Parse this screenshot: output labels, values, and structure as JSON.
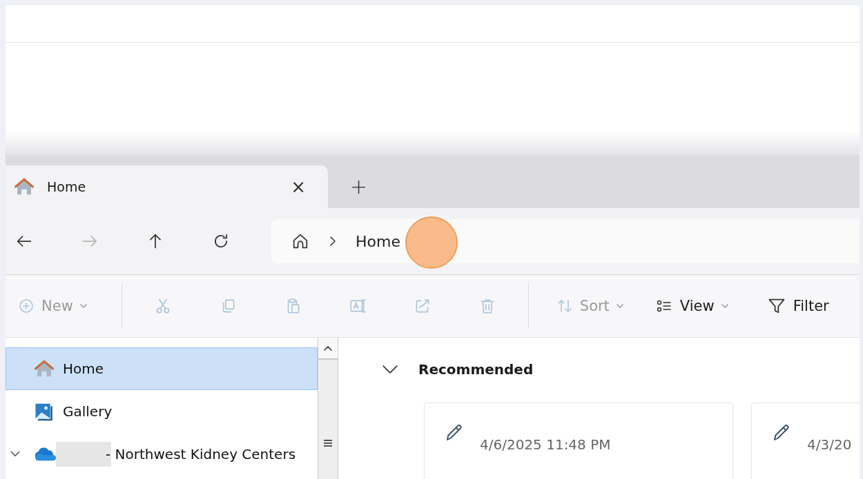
{
  "tabs": [
    {
      "label": "Home",
      "selected": true,
      "close": "×"
    }
  ],
  "new_tab_button": "+",
  "navigation": {
    "back_disabled": false,
    "forward_disabled": true,
    "address": {
      "breadcrumb": [
        "Home"
      ]
    }
  },
  "toolbar": [
    {
      "kind": "dropdown",
      "label": "New",
      "disabled": true
    },
    {
      "kind": "divider"
    },
    {
      "kind": "icon",
      "disabled": true
    },
    {
      "kind": "icon",
      "disabled": true
    },
    {
      "kind": "icon",
      "disabled": true
    },
    {
      "kind": "icon",
      "disabled": true
    },
    {
      "kind": "icon",
      "disabled": true
    },
    {
      "kind": "icon",
      "disabled": true
    },
    {
      "kind": "divider"
    },
    {
      "kind": "dropdown",
      "label": "Sort",
      "disabled": true
    },
    {
      "kind": "dropdown",
      "label": "View",
      "disabled": false
    },
    {
      "kind": "button",
      "label": "Filter",
      "disabled": false
    }
  ],
  "sidebar": {
    "items": [
      {
        "label": "Home",
        "selected": true
      },
      {
        "label": "Gallery",
        "selected": false
      },
      {
        "label": "- Northwest Kidney Centers",
        "selected": false,
        "expanded": true,
        "redacted": true
      }
    ]
  },
  "content": {
    "section": {
      "title": "Recommended",
      "expanded": true
    },
    "cards": [
      {
        "date": "4/6/2025 11:48 PM"
      },
      {
        "date": "4/3/20"
      }
    ]
  }
}
